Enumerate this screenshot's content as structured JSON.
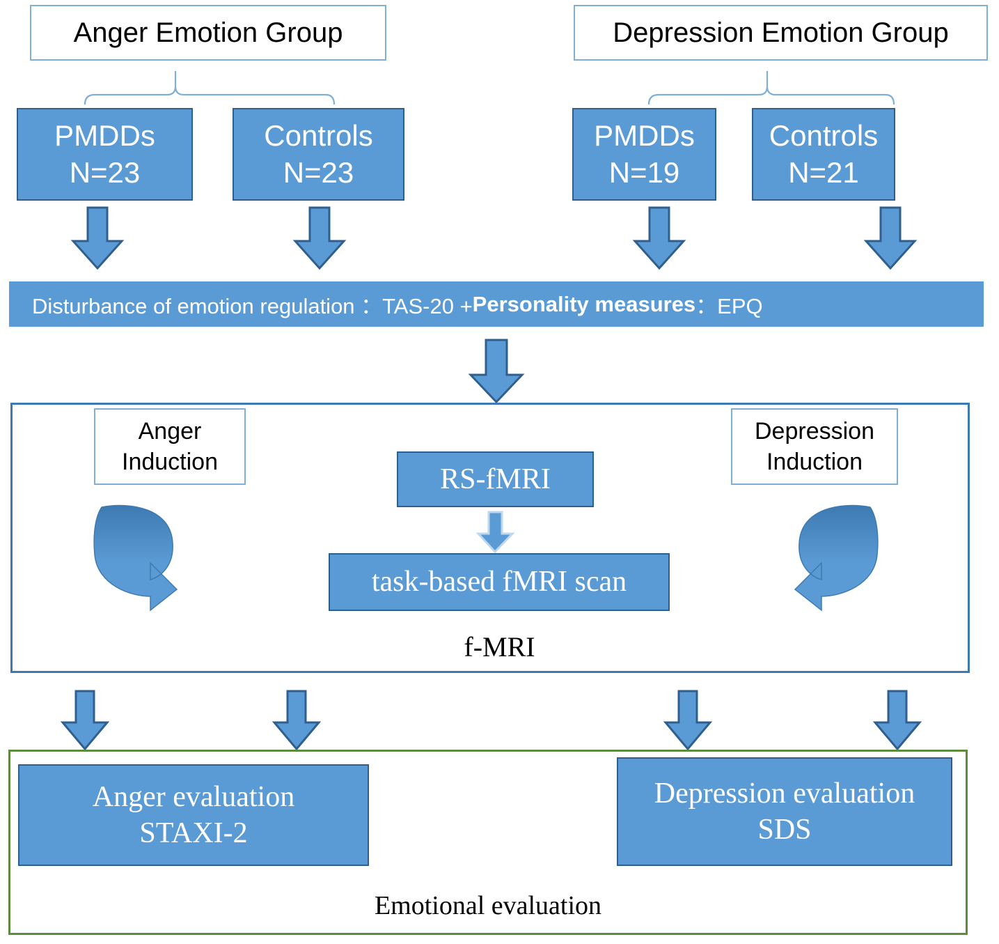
{
  "diagram": {
    "title_boxes": [
      {
        "label": "Anger Emotion Group"
      },
      {
        "label": "Depression Emotion Group"
      }
    ],
    "anger_group": {
      "pmdd": {
        "name": "PMDDs",
        "n": "N=23"
      },
      "control": {
        "name": "Controls",
        "n": "N=23"
      }
    },
    "depression_group": {
      "pmdd": {
        "name": "PMDDs",
        "n": "N=19"
      },
      "control": {
        "name": "Controls",
        "n": "N=21"
      }
    },
    "measures_banner": {
      "part1": "Disturbance of emotion regulation ：TAS-20 +",
      "bold": "Personality measures",
      "part2": "：EPQ"
    },
    "fmri_section": {
      "caption": "f-MRI",
      "anger_induction": {
        "line1": "Anger",
        "line2": "Induction"
      },
      "depression_induction": {
        "line1": "Depression",
        "line2": "Induction"
      },
      "rs_fmri": "RS-fMRI",
      "task_fmri": "task-based fMRI scan"
    },
    "evaluation_section": {
      "caption": "Emotional evaluation",
      "anger": {
        "line1": "Anger evaluation",
        "line2": "STAXI-2"
      },
      "depression": {
        "line1": "Depression evaluation",
        "line2": "SDS"
      }
    },
    "colors": {
      "box_fill": "#5B9BD5",
      "box_border": "#2F5F8F",
      "title_border": "#7FAFD4",
      "container_blue": "#3E7AB2",
      "container_green": "#5E8C3E",
      "arrow_fill": "#5B9BD5",
      "arrow_stroke": "#2F5F8F",
      "text_white": "#FFFFFF",
      "text_black": "#000000"
    }
  }
}
